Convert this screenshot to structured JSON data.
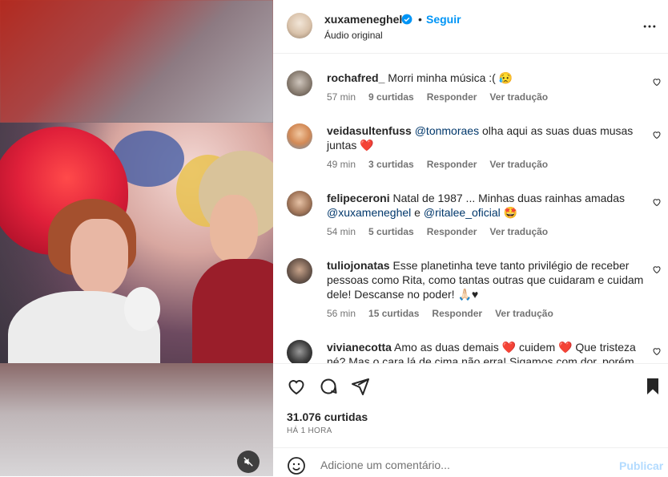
{
  "post": {
    "username": "xuxameneghel",
    "separator": "•",
    "follow_label": "Seguir",
    "audio_label": "Áudio original"
  },
  "comments": [
    {
      "user": "rochafred_",
      "text": " Morri minha música :( 😥",
      "time": "57 min",
      "likes": "9 curtidas",
      "reply": "Responder",
      "translate": "Ver tradução"
    },
    {
      "user": "veidasultenfuss",
      "mention1": "@tonmoraes",
      "text": " olha aqui as suas duas musas juntas ❤️",
      "time": "49 min",
      "likes": "3 curtidas",
      "reply": "Responder",
      "translate": "Ver tradução"
    },
    {
      "user": "felipeceroni",
      "text_a": " Natal de 1987 ... Minhas duas rainhas amadas ",
      "mention1": "@xuxameneghel",
      "text_b": " e ",
      "mention2": "@ritalee_oficial",
      "text_c": " 🤩",
      "time": "54 min",
      "likes": "5 curtidas",
      "reply": "Responder",
      "translate": "Ver tradução"
    },
    {
      "user": "tuliojonatas",
      "text": " Esse planetinha teve tanto privilégio de receber pessoas como Rita, como tantas outras que cuidaram e cuidam dele! Descanse no poder! 🙏🏻♥",
      "time": "56 min",
      "likes": "15 curtidas",
      "reply": "Responder",
      "translate": "Ver tradução"
    },
    {
      "user": "vivianecotta",
      "text": " Amo as duas demais ❤️ cuidem ❤️ Que tristeza né? Mas o cara lá de cima não erra! Sigamos com dor, porém"
    }
  ],
  "actions": {
    "likes_count": "31.076 curtidas",
    "time_ago": "HÁ 1 HORA"
  },
  "add_comment": {
    "placeholder": "Adicione um comentário...",
    "post_label": "Publicar"
  },
  "icons": {
    "verified": "verified-badge-icon",
    "more": "more-options-icon",
    "like": "heart-icon",
    "comment": "comment-icon",
    "share": "share-icon",
    "save": "bookmark-icon",
    "emoji": "emoji-icon",
    "mute": "muted-speaker-icon"
  },
  "colors": {
    "accent": "#0095f6",
    "post_disabled": "#b3dbff",
    "secondary_text": "#737373",
    "mention": "#00376b"
  }
}
